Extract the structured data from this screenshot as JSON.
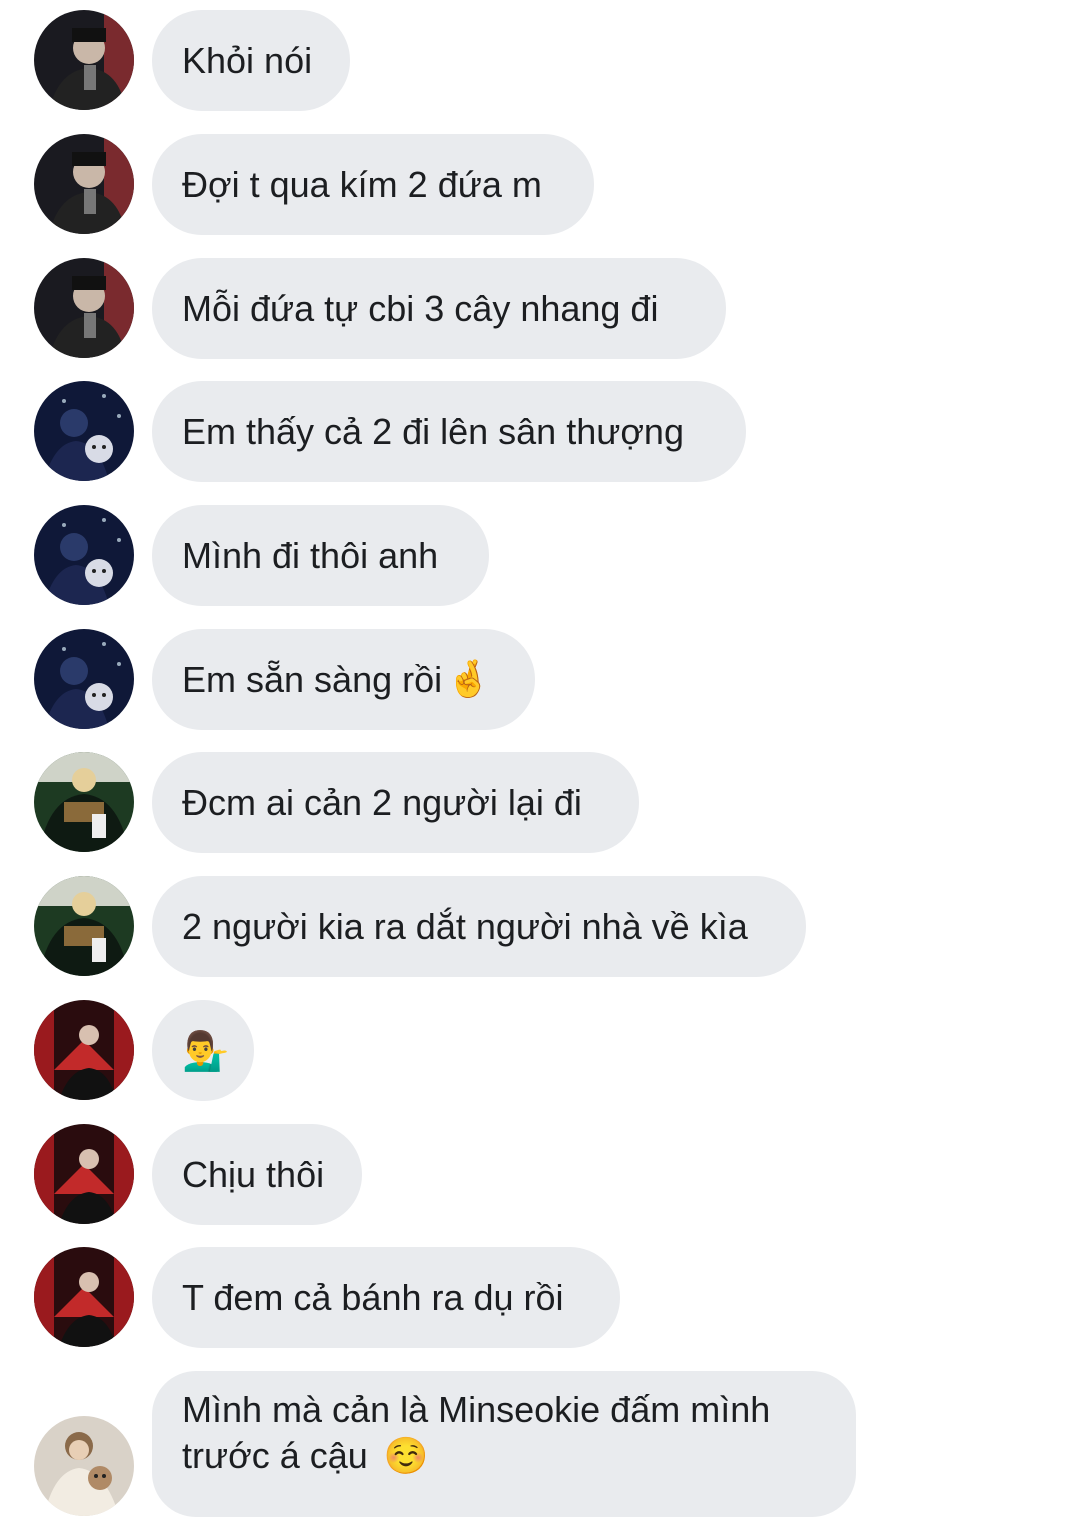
{
  "messages": [
    {
      "sender": "user-1",
      "text": "Khỏi nói"
    },
    {
      "sender": "user-1",
      "text": "Đợi t qua kím 2 đứa m"
    },
    {
      "sender": "user-1",
      "text": "Mỗi đứa tự cbi 3 cây nhang đi"
    },
    {
      "sender": "user-2",
      "text": "Em thấy cả 2 đi lên sân thượng"
    },
    {
      "sender": "user-2",
      "text": "Mình đi thôi anh"
    },
    {
      "sender": "user-2",
      "text": "Em sẵn sàng rồi",
      "emoji": "🤞"
    },
    {
      "sender": "user-3",
      "text": "Đcm ai cản 2 người lại đi"
    },
    {
      "sender": "user-3",
      "text": "2 người kia ra dắt người nhà về kìa"
    },
    {
      "sender": "user-4",
      "text": "",
      "emoji": "💁‍♂️"
    },
    {
      "sender": "user-4",
      "text": "Chịu thôi"
    },
    {
      "sender": "user-4",
      "text": "T đem cả bánh ra dụ rồi"
    },
    {
      "sender": "user-5",
      "text_line1": "Mình mà cản là Minseokie đấm mình",
      "text_line2": "trước á cậu",
      "emoji": "☺️"
    }
  ],
  "colors": {
    "bubble_bg": "#e9ebee",
    "text": "#1c1e21",
    "background": "#ffffff"
  }
}
